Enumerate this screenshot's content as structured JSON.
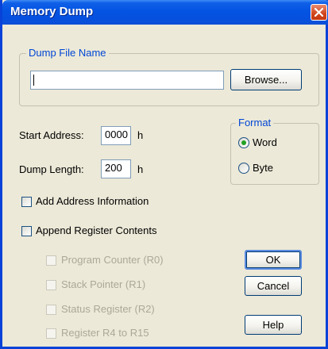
{
  "window": {
    "title": "Memory Dump"
  },
  "dump_file": {
    "legend": "Dump File Name",
    "value": "",
    "browse_label": "Browse..."
  },
  "start_address": {
    "label": "Start Address:",
    "value": "0000",
    "suffix": "h"
  },
  "dump_length": {
    "label": "Dump Length:",
    "value": "200",
    "suffix": "h"
  },
  "format": {
    "legend": "Format",
    "options": [
      {
        "label": "Word",
        "selected": true
      },
      {
        "label": "Byte",
        "selected": false
      }
    ]
  },
  "checkboxes": {
    "add_address": {
      "label": "Add Address Information",
      "checked": false
    },
    "append_registers": {
      "label": "Append Register Contents",
      "checked": false
    }
  },
  "registers": [
    {
      "label": "Program Counter (R0)",
      "checked": false,
      "enabled": false
    },
    {
      "label": "Stack Pointer (R1)",
      "checked": false,
      "enabled": false
    },
    {
      "label": "Status Register (R2)",
      "checked": false,
      "enabled": false
    },
    {
      "label": "Register R4 to R15",
      "checked": false,
      "enabled": false
    }
  ],
  "buttons": {
    "ok": "OK",
    "cancel": "Cancel",
    "help": "Help"
  },
  "colors": {
    "titlebar": "#0454e2",
    "group_legend": "#0046d5",
    "disabled_text": "#aca899"
  }
}
